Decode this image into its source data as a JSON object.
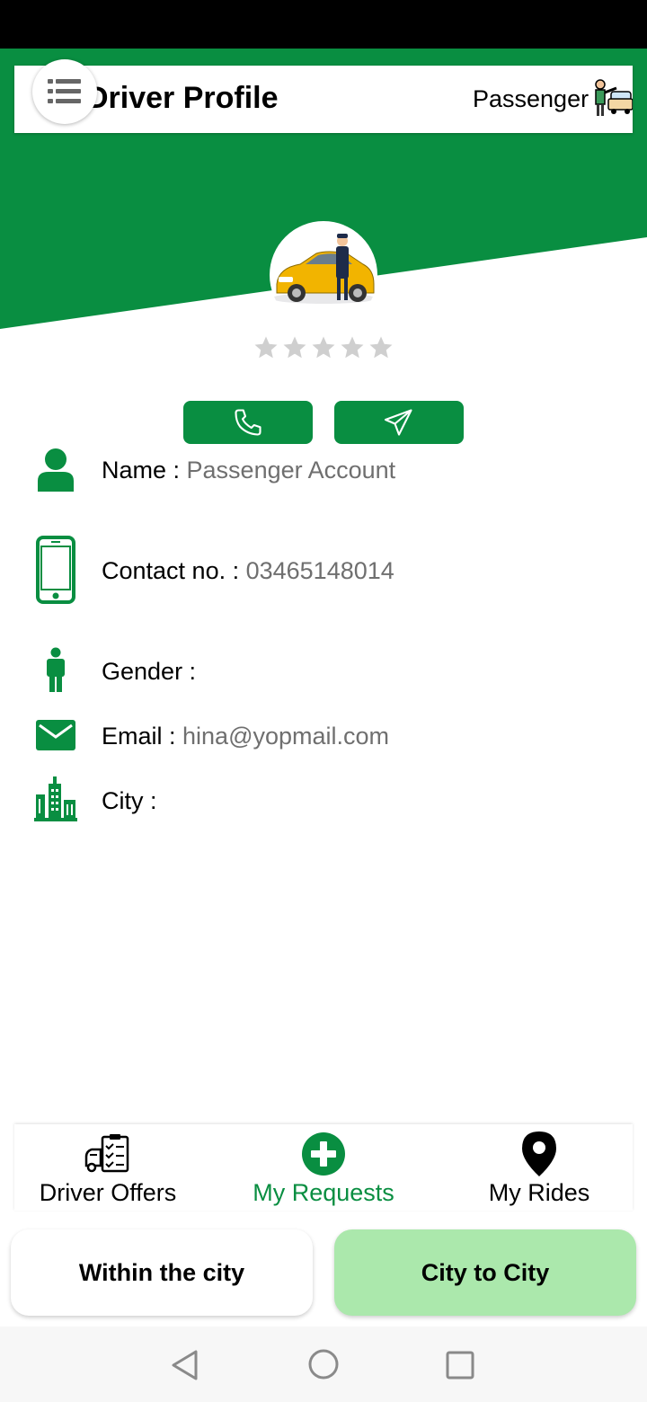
{
  "colors": {
    "primary": "#098E41",
    "accent_light": "#ABE8AC",
    "star_inactive": "#CFCFCF"
  },
  "header": {
    "title": "Driver Profile",
    "mode_label": "Passenger",
    "menu_icon": "list-icon",
    "mode_icon": "passenger-taxi-icon"
  },
  "profile": {
    "avatar": "taxi-driver-avatar",
    "rating": 0,
    "rating_max": 5,
    "actions": [
      {
        "icon": "phone-icon"
      },
      {
        "icon": "send-icon"
      }
    ]
  },
  "info": {
    "name_label": "Name : ",
    "name_value": "Passenger Account",
    "contact_label": "Contact no. : ",
    "contact_value": " 03465148014",
    "gender_label": "Gender : ",
    "gender_value": "",
    "email_label": "Email : ",
    "email_value": "hina@yopmail.com",
    "city_label": "City : ",
    "city_value": ""
  },
  "bottom_nav": {
    "items": [
      {
        "label": "Driver Offers",
        "icon": "driver-offers-icon",
        "active": false
      },
      {
        "label": "My Requests",
        "icon": "add-circle-icon",
        "active": true
      },
      {
        "label": "My Rides",
        "icon": "location-pin-icon",
        "active": false
      }
    ]
  },
  "ride_modes": {
    "within_city": "Within the city",
    "city_to_city": "City to City",
    "selected": "city_to_city"
  }
}
